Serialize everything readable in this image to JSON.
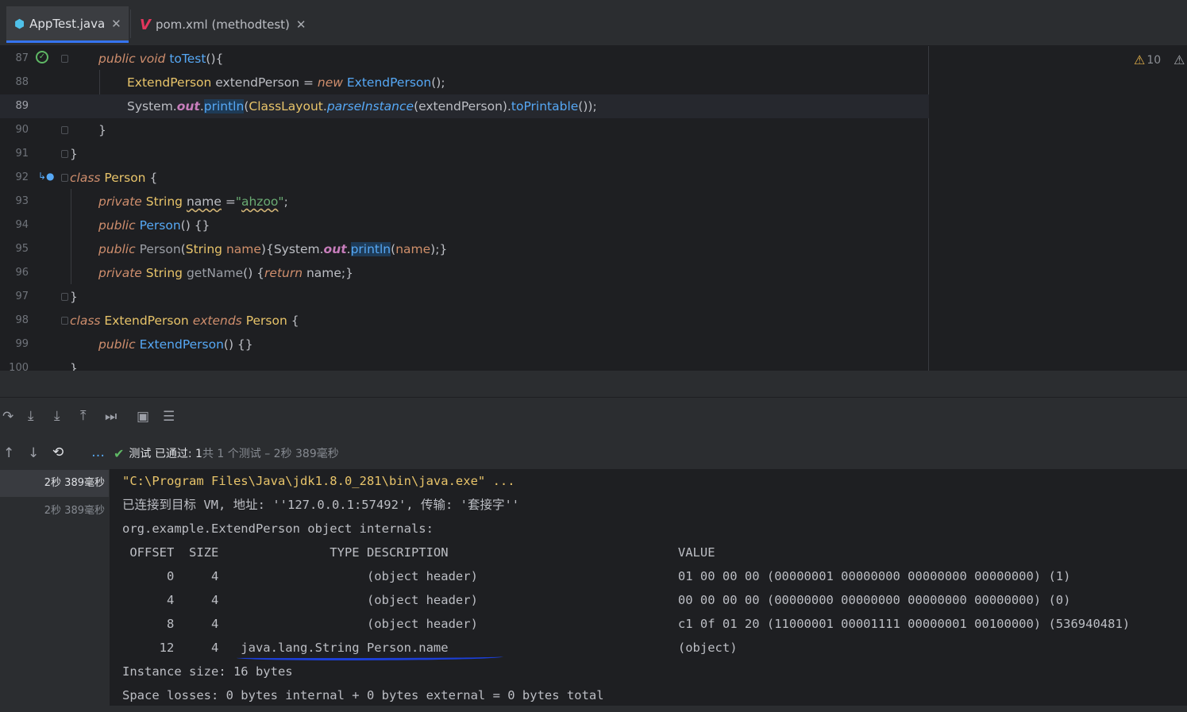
{
  "tabs": [
    {
      "label": "AppTest.java",
      "icon": "java-class-icon",
      "active": true
    },
    {
      "label": "pom.xml (methodtest)",
      "icon": "maven-icon",
      "active": false
    }
  ],
  "editor": {
    "warnings_count": "10",
    "line_numbers": [
      "87",
      "88",
      "89",
      "90",
      "91",
      "92",
      "93",
      "94",
      "95",
      "96",
      "97",
      "98",
      "99",
      "100"
    ]
  },
  "test_status": {
    "label": "测试 已通过: 1",
    "detail": "共 1 个测试 – 2秒 389毫秒"
  },
  "tree": [
    {
      "label": "2秒 389毫秒",
      "selected": true
    },
    {
      "label": "2秒 389毫秒",
      "selected": false
    }
  ],
  "console": {
    "cmd": "\"C:\\Program Files\\Java\\jdk1.8.0_281\\bin\\java.exe\" ...",
    "connected": "已连接到目标 VM, 地址: ''127.0.0.1:57492', 传输: '套接字''",
    "object": "org.example.ExtendPerson object internals:",
    "header": " OFFSET  SIZE               TYPE DESCRIPTION                               VALUE",
    "rows": [
      "      0     4                    (object header)                           01 00 00 00 (00000001 00000000 00000000 00000000) (1)",
      "      4     4                    (object header)                           00 00 00 00 (00000000 00000000 00000000 00000000) (0)",
      "      8     4                    (object header)                           c1 0f 01 20 (11000001 00001111 00000001 00100000) (536940481)",
      "     12     4   java.lang.String Person.name                               (object)"
    ],
    "instance_size": "Instance size: 16 bytes",
    "space_losses": "Space losses: 0 bytes internal + 0 bytes external = 0 bytes total"
  }
}
